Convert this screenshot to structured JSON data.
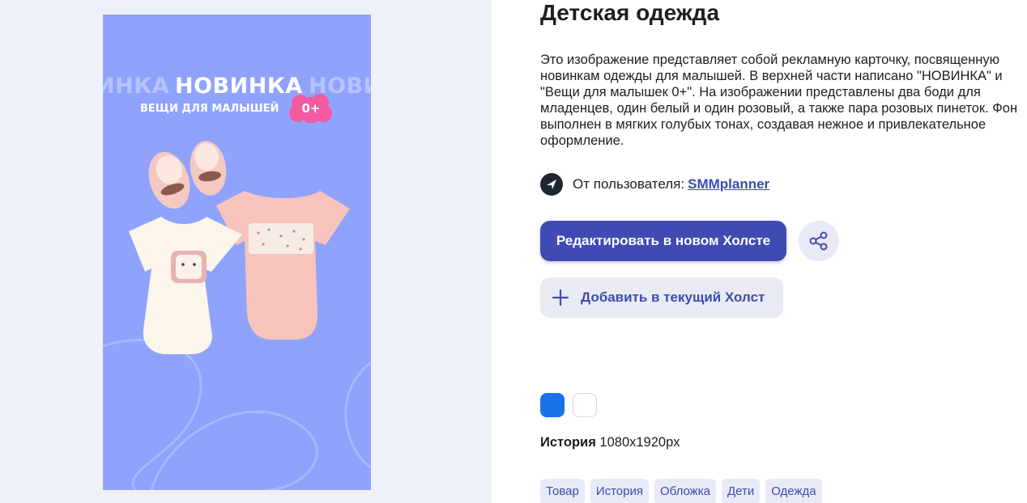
{
  "preview": {
    "headline_ghost_left": "ИНКА",
    "headline_main": "НОВИНКА",
    "headline_ghost_right": "НОВИ",
    "subline": "ВЕЩИ ДЛЯ МАЛЫШЕЙ",
    "age_badge": "0+",
    "background_color": "#8fa3fd"
  },
  "template": {
    "title": "Детская одежда",
    "description": "Это изображение представляет собой рекламную карточку, посвященную новинкам одежды для малышей. В верхней части написано \"НОВИНКА\" и \"Вещи для малышек 0+\". На изображении представлены два боди для младенцев, один белый и один розовый, а также пара розовых пинеток. Фон выполнен в мягких голубых тонах, создавая нежное и привлекательное оформление."
  },
  "author": {
    "label": "От пользователя:",
    "name": "SMMplanner",
    "avatar_icon": "send-arrow-icon"
  },
  "actions": {
    "edit_label": "Редактировать в новом Холсте",
    "add_label": "Добавить в текущий Холст",
    "share_icon": "share-icon",
    "accent_color": "#3f4bb3"
  },
  "colors": [
    "#1a73e8",
    "#ffffff"
  ],
  "format": {
    "name": "История",
    "size": "1080x1920px"
  },
  "tags": [
    "Товар",
    "История",
    "Обложка",
    "Дети",
    "Одежда"
  ]
}
